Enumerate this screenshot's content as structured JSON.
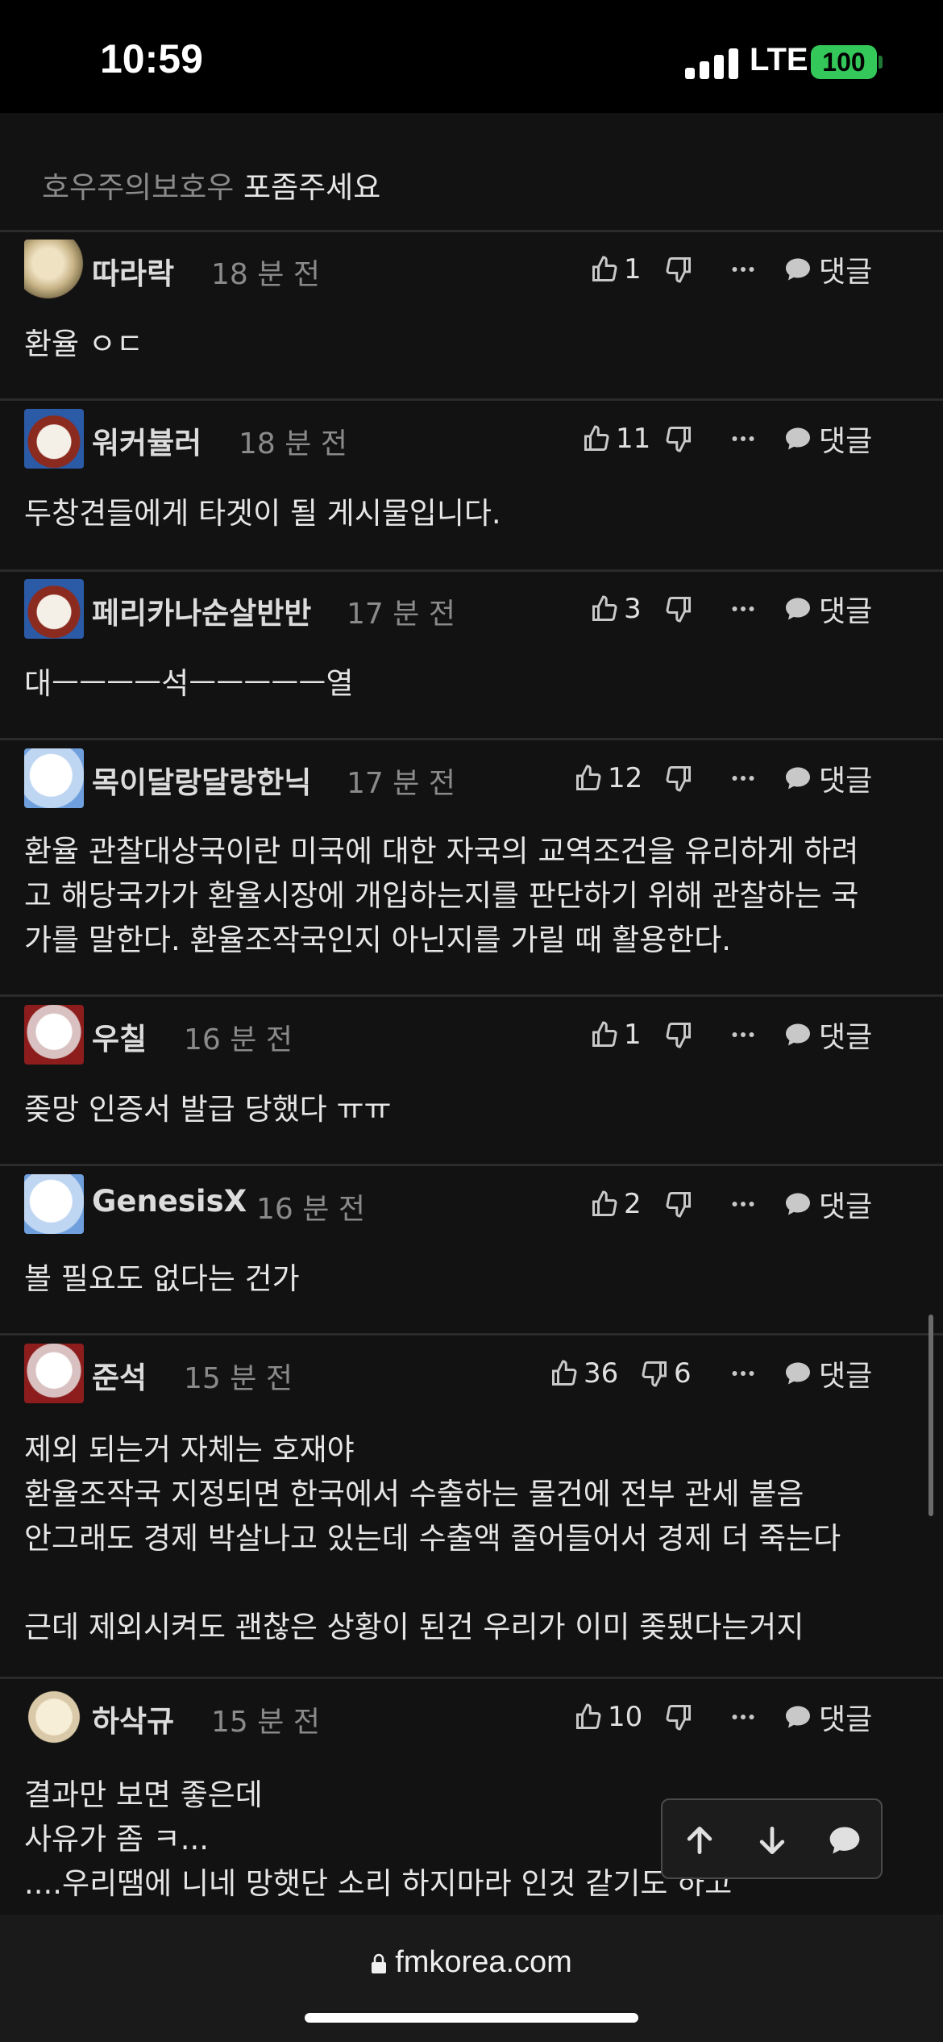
{
  "status_bar": {
    "time": "10:59",
    "network": "LTE",
    "battery": "100"
  },
  "partial_comment": {
    "mention": "호우주의보호우",
    "text": "포좀주세요"
  },
  "comments": [
    {
      "nickname": "따라락",
      "time": "18 분 전",
      "likes": "1",
      "dislikes": "",
      "reply": "댓글",
      "avatar": "ball-avatar",
      "text": "환율 ㅇㄷ"
    },
    {
      "nickname": "워커뷸러",
      "time": "18 분 전",
      "likes": "11",
      "dislikes": "",
      "reply": "댓글",
      "avatar": "dog-avatar",
      "text": "두창견들에게 타겟이 될 게시물입니다."
    },
    {
      "nickname": "페리카나순살반반",
      "time": "17 분 전",
      "likes": "3",
      "dislikes": "",
      "reply": "댓글",
      "avatar": "dog-avatar",
      "text": "대ㅡㅡㅡㅡ석ㅡㅡㅡㅡㅡ열"
    },
    {
      "nickname": "목이달랑달랑한닉",
      "time": "17 분 전",
      "likes": "12",
      "dislikes": "",
      "reply": "댓글",
      "avatar": "white-dog-avatar",
      "text": "환율 관찰대상국이란 미국에 대한 자국의 교역조건을 유리하게 하려\n고 해당국가가 환율시장에 개입하는지를 판단하기 위해 관찰하는 국\n가를 말한다. 환율조작국인지 아닌지를 가릴 때 활용한다."
    },
    {
      "nickname": "우칠",
      "time": "16 분 전",
      "likes": "1",
      "dislikes": "",
      "reply": "댓글",
      "avatar": "cat-avatar",
      "text": "좆망 인증서 발급 당했다 ㅠㅠ"
    },
    {
      "nickname": "GenesisX",
      "time": "16 분 전",
      "likes": "2",
      "dislikes": "",
      "reply": "댓글",
      "avatar": "white-dog-avatar",
      "text": "볼 필요도 없다는 건가"
    },
    {
      "nickname": "준석",
      "time": "15 분 전",
      "likes": "36",
      "dislikes": "6",
      "reply": "댓글",
      "avatar": "cat-avatar",
      "text": "제외 되는거 자체는 호재야\n환율조작국 지정되면 한국에서 수출하는 물건에 전부 관세 붙음\n안그래도 경제 박살나고 있는데 수출액 줄어들어서 경제 더 죽는다\n\n근데 제외시켜도 괜찮은 상황이 된건 우리가 이미 좆됐다는거지"
    },
    {
      "nickname": "하삭규",
      "time": "15 분 전",
      "likes": "10",
      "dislikes": "",
      "reply": "댓글",
      "avatar": "puppy-avatar",
      "text": "결과만 보면 좋은데\n사유가 좀 ㅋ...\n....우리땜에 니네 망햇단 소리 하지마라 인것 같기도 하고"
    }
  ],
  "float_nav": {
    "up": "arrow-up-icon",
    "down": "arrow-down-icon",
    "comment": "comment-icon"
  },
  "browser": {
    "url": "fmkorea.com"
  }
}
